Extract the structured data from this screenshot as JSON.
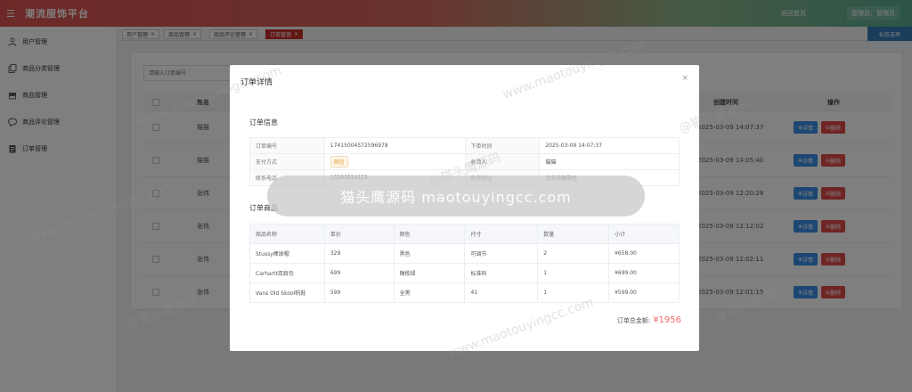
{
  "header": {
    "brand": "潮流服饰平台",
    "back_home": "返回首页",
    "admin": "管理员：管理员"
  },
  "sidebar": {
    "items": [
      {
        "label": "用户管理",
        "icon": "user-icon"
      },
      {
        "label": "商品分类管理",
        "icon": "copy-icon"
      },
      {
        "label": "商品管理",
        "icon": "box-icon"
      },
      {
        "label": "商品评论管理",
        "icon": "comment-icon"
      },
      {
        "label": "订单管理",
        "icon": "order-icon"
      }
    ]
  },
  "tabs": [
    {
      "label": "用户管理",
      "active": false
    },
    {
      "label": "商品管理",
      "active": false
    },
    {
      "label": "商品评论管理",
      "active": false
    },
    {
      "label": "订单管理",
      "active": true
    }
  ],
  "tabs_close_all": "标签选项",
  "main": {
    "search_placeholder": "请输入订单编号",
    "table": {
      "col_name": "姓名",
      "col_created": "创建时间",
      "col_actions": "操作",
      "rows": [
        {
          "name": "猫猫",
          "created": "2025-03-09 14:07:37"
        },
        {
          "name": "猫猫",
          "created": "2025-03-09 14:05:40"
        },
        {
          "name": "张伟",
          "created": "2025-03-09 12:20:28"
        },
        {
          "name": "张伟",
          "created": "2025-03-09 12:12:02"
        },
        {
          "name": "张伟",
          "created": "2025-03-09 12:02:11"
        },
        {
          "name": "张伟",
          "created": "2025-03-09 12:01:15"
        }
      ],
      "detail_label": "详情",
      "delete_label": "删除"
    }
  },
  "modal": {
    "title": "订单详情",
    "close": "×",
    "info_title": "订单信息",
    "info": {
      "order_no_label": "订单编号",
      "order_no": "1741500457259697​8",
      "order_time_label": "下单时间",
      "order_time": "2025-03-09 14:07:37",
      "pay_label": "支付方式",
      "pay": "微信",
      "receiver_label": "收货人",
      "receiver": "猫猫",
      "phone_label": "联系电话",
      "phone": "15263524123",
      "address_label": "收货地址",
      "address": "北京市朝阳区"
    },
    "items_title": "订单商品",
    "items_headers": [
      "商品名称",
      "单价",
      "颜色",
      "尺寸",
      "数量",
      "小计"
    ],
    "items": [
      [
        "Stussy棒球帽",
        "329",
        "黑色",
        "可调节",
        "2",
        "¥658.00"
      ],
      [
        "Carhartt双肩包",
        "699",
        "橄榄绿",
        "标准码",
        "1",
        "¥699.00"
      ],
      [
        "Vans Old Skool帆鞋",
        "599",
        "全黑",
        "41",
        "1",
        "¥599.00"
      ]
    ],
    "total_label": "订单总金额:",
    "total_amount": "¥1956"
  },
  "watermark": {
    "banner": "猫头鹰源码 maotouyingcc.com",
    "text": "www.maotouyingcc.com",
    "text_cn": "@猫头鹰源码"
  },
  "colors": {
    "header_start": "#d9534f",
    "header_end": "#57a98f",
    "active_tab": "#c9302c",
    "primary": "#3a8ee6",
    "danger": "#e04b4b",
    "total": "#f56c6c"
  }
}
